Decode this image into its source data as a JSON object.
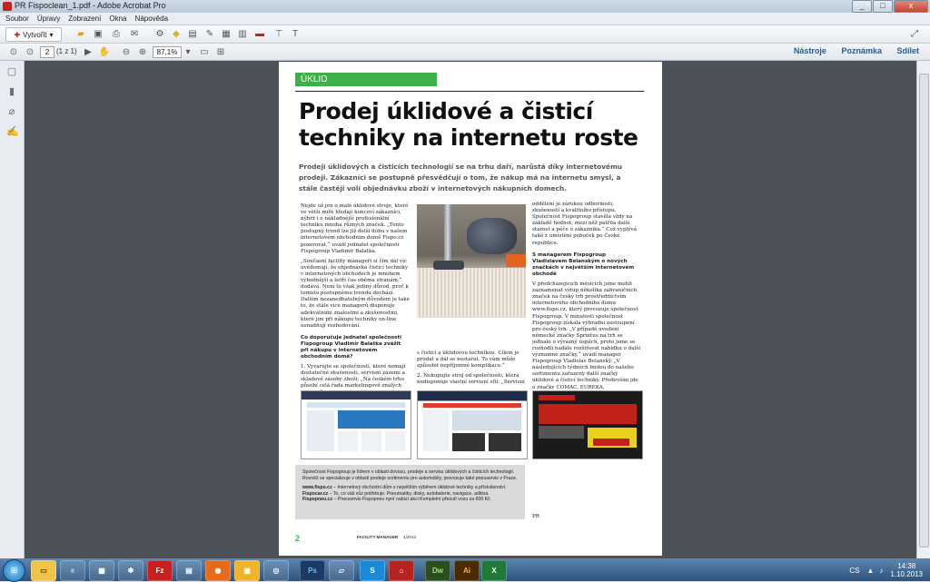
{
  "window": {
    "title": "PR Fispoclean_1.pdf - Adobe Acrobat Pro",
    "min": "_",
    "max": "□",
    "close": "x"
  },
  "menu": [
    "Soubor",
    "Úpravy",
    "Zobrazení",
    "Okna",
    "Nápověda"
  ],
  "toolbar": {
    "create_label": "Vytvořit",
    "create_caret": "▾"
  },
  "nav": {
    "page_current": "2",
    "page_total": "(1 z 1)",
    "zoom": "87,1%"
  },
  "right_links": [
    "Nástroje",
    "Poznámka",
    "Sdílet"
  ],
  "article": {
    "section": "ÚKLID",
    "headline": "Prodej úklidové a čisticí techniky na internetu roste",
    "lead": "Prodeji úklidových a čisticích technologií se na trhu daří, narůstá díky internetovému prodeji. Zákazníci se postupně přesvědčují o tom, že nákup má na internetu smysl, a stále častěji volí objednávku zboží v internetových nákupních domech.",
    "col1_p1": "Nejde už jen o malé úklidové stroje, které ve větší míře hledají koncoví zákazníci, nýbrž i o nákladnější profesionální techniku mnoha různých značek. „Tento postupný trend lze již delší dobu v našem internetovém obchodním domě Fispo.cz pozorovat,“ uvádí jednatel společnosti Fispogroup Vladimír Balatka.",
    "col1_p2": "„Současní facility manageři si čím dál víc uvědomují, že objednávka čisticí techniky v internetových obchodech je mnohem výhodnější a šetří čas oběma stranám,“ dodává. Není to však jediný důvod, proč k tomuto postupnému trendu dochází. Dalším nezanedbatelným důvodem je také to, že stále více managerů disponuje adekvátními znalostmi a zkušenostmi, které jim při nákupu techniky on-line usnadňují rozhodování.",
    "col1_h": "Co doporučuje jednatel společnosti Fispogroup Vladimír Balatka zvážit při nákupu v internetovém obchodním domě?",
    "col1_p3": "1. Vyvarujte se společností, které nemají dostatečné zkušenosti, servisní zázemí a skladové zásoby zboží: „Na českém trhu působí celá řada marketingově znalých prodejců bez odpovídajících znalostí a zkušeností",
    "col2_p1": "s čisticí a úklidovou technikou. Cílem je prodat a dál se nestarat. To vám může způsobit nepříjemné komplikace.“",
    "col2_p2": "2. Nekupujte stroj od společnosti, která nedisponuje vlastní servisní sítí: „Servisní",
    "col3_p1": "oddělení je zárukou odbornosti, zkušeností a kvalitního přístupu. Společnost Fispogroup stavěla vždy na základě hodnot, mezi něž patřila další starost a péče o zákazníka.“ Což vyplývá také z umístění poboček po České republice.",
    "col3_h": "S managerem Fispogroup Vladislavem Belanským o nových značkách v největším internetovém obchodě",
    "col3_p2": "V předcházejících měsících jsme mohli zaznamenat vstup několika zahraničních značek na český trh prostřednictvím internetového obchodního domu www.fispo.cz, který provozuje společnost Fispogroup. V minulosti společnost Fispogroup získala výhradní zastoupení pro český trh. „V případě uvedení německé značky Sprintus na trh se jednalo o výrazný úspěch, proto jsme se rozhodli nadále rozšiřovat nabídku o další významné značky,“ uvádí manager Fispogroup Vladislav Belanský. „V následujících týdnech budou do našeho sortimentu zařazeny další značky úklidové a čisticí techniky. Především jde o značky COMAC, EUREKA, SANTOEMMA. Samozřejmě i nadále budou probíhat jednání s novými dodavateli. Sortiment v internetovém obchodním domě Fispo.cz hodláme i nadále rozšiřovat,“ dodává závěrem Vladislav Belanský.",
    "col3_sign": "PR",
    "info_p1": "Společnost Fispogroup je lídrem v oblasti dovozu, prodeje a servisu úklidových a čisticích technologií. Rovněž se specializuje v oblasti prodeje sortimentu pro automobily, provozuje také pneuservis v Praze.",
    "info_l1_b": "www.fispo.cz",
    "info_l1": " – Internetový obchodní dům s největším výběrem úklidové techniky a příslušenství.",
    "info_l2_b": "Fispocar.cz",
    "info_l2": " – To, co váš vůz potřebuje. Pneumatiky, disky, autobaterie, navigace, aditiva.",
    "info_l3_b": "Fispopneu.cz",
    "info_l3": " – Pneuservis Fispopneu nyní nabízí akci Kompletní přezutí vozu za 600 Kč.",
    "page_number": "2",
    "magazine": "FACILITY MANAGER",
    "issue": "4/2013"
  },
  "taskbar": {
    "apps": [
      "Ps",
      "Dw",
      "Ai",
      "S"
    ],
    "lang": "CS",
    "time": "14:38",
    "date": "1.10.2013"
  },
  "colors": {
    "accent_green": "#3db04a",
    "dark_bg": "#4c5057"
  }
}
